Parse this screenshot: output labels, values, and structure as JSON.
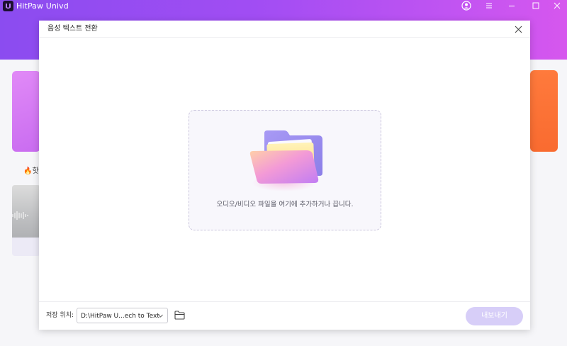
{
  "app": {
    "name": "HitPaw Univd"
  },
  "background": {
    "hot_label": "🔥핫"
  },
  "dialog": {
    "title": "음성 텍스트 전환",
    "dropzone_hint": "오디오/비디오 파일을 여기에 추가하거나 끕니다.",
    "save_location_label": "저장 위치:",
    "save_path": "D:\\HitPaw U...ech to Text",
    "export_label": "내보내기"
  },
  "icons": {
    "window": [
      "account-icon",
      "menu-icon",
      "minimize-icon",
      "maximize-icon",
      "close-icon"
    ],
    "dialog": [
      "close-icon",
      "folder-illustration",
      "chevron-down-icon",
      "folder-icon"
    ]
  },
  "colors": {
    "titlebar_start": "#8b4cf0",
    "titlebar_end": "#d657ee",
    "export_button_disabled": "#d7cef8",
    "card_left": "#c96cf0",
    "card_right": "#f96b30"
  }
}
